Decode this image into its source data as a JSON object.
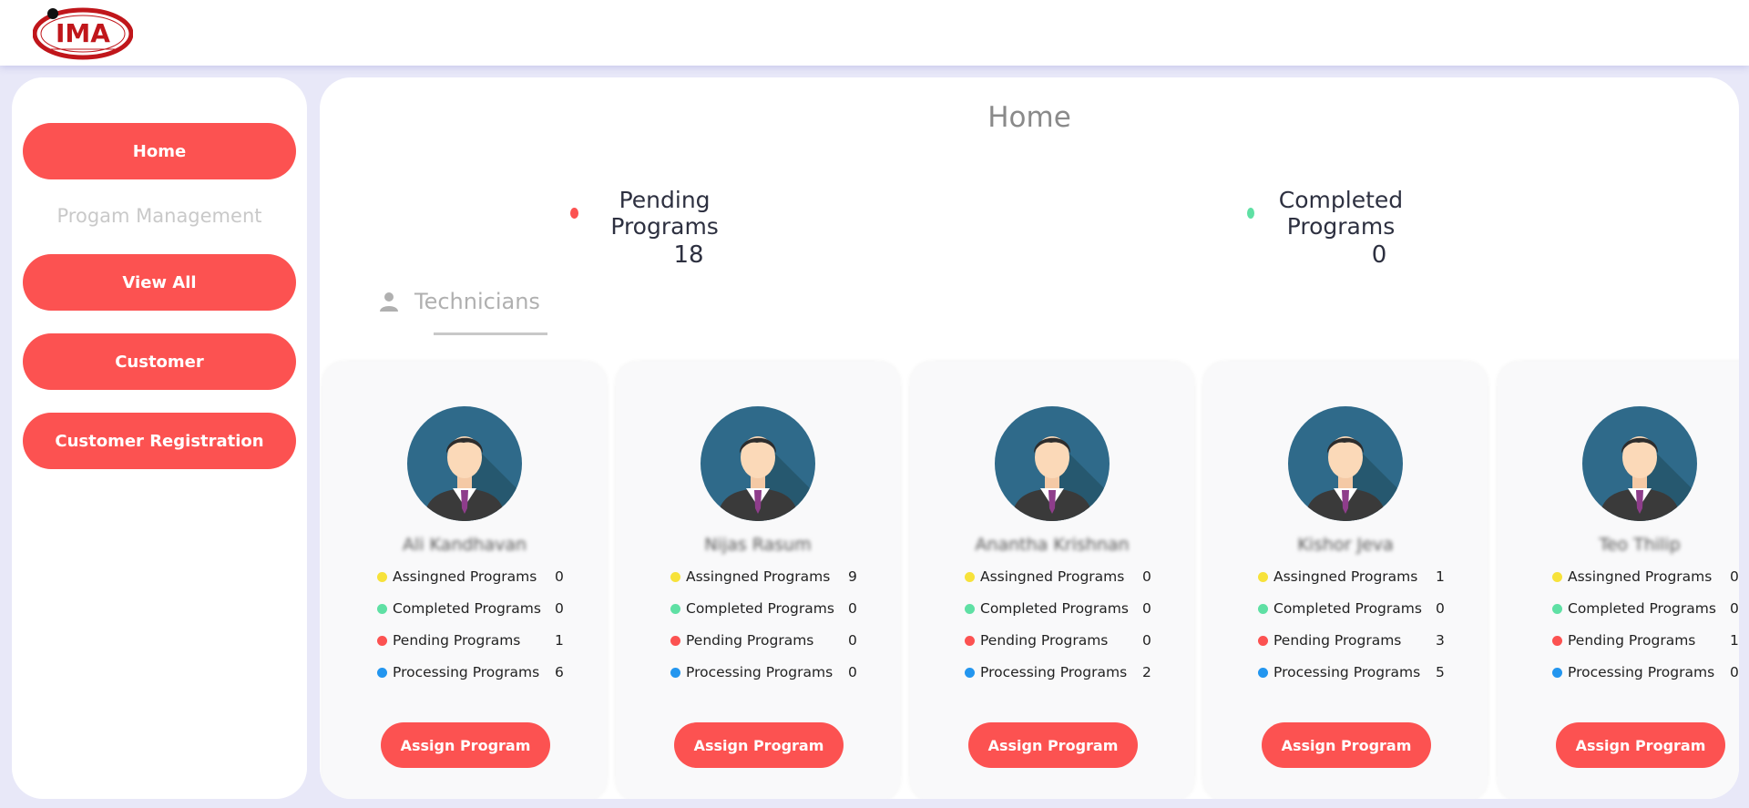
{
  "header": {
    "logo_text": "IMA"
  },
  "colors": {
    "accent": "#fc5251",
    "assigned": "#f7e23a",
    "completed": "#5fe0a4",
    "pending": "#fc5251",
    "processing": "#2396ef"
  },
  "sidebar": {
    "home_label": "Home",
    "section_label": "Progam Management",
    "view_all_label": "View All",
    "customer_label": "Customer",
    "customer_registration_label": "Customer Registration"
  },
  "main": {
    "title": "Home",
    "pending": {
      "label": "Pending Programs",
      "value": "18"
    },
    "completed": {
      "label": "Completed Programs",
      "value": "0"
    },
    "technicians_tab": "Technicians"
  },
  "technicians": [
    {
      "name": "Ali Kandhavan",
      "assigned": "0",
      "completed": "0",
      "pending": "1",
      "processing": "6"
    },
    {
      "name": "Nijas Rasum",
      "assigned": "9",
      "completed": "0",
      "pending": "0",
      "processing": "0"
    },
    {
      "name": "Anantha Krishnan",
      "assigned": "0",
      "completed": "0",
      "pending": "0",
      "processing": "2"
    },
    {
      "name": "Kishor Jeva",
      "assigned": "1",
      "completed": "0",
      "pending": "3",
      "processing": "5"
    },
    {
      "name": "Teo Thilip",
      "assigned": "0",
      "completed": "0",
      "pending": "1",
      "processing": "0"
    }
  ],
  "card_labels": {
    "assigned": "Assingned Programs",
    "completed": "Completed Programs",
    "pending": "Pending Programs",
    "processing": "Processing Programs",
    "assign_button": "Assign Program"
  }
}
